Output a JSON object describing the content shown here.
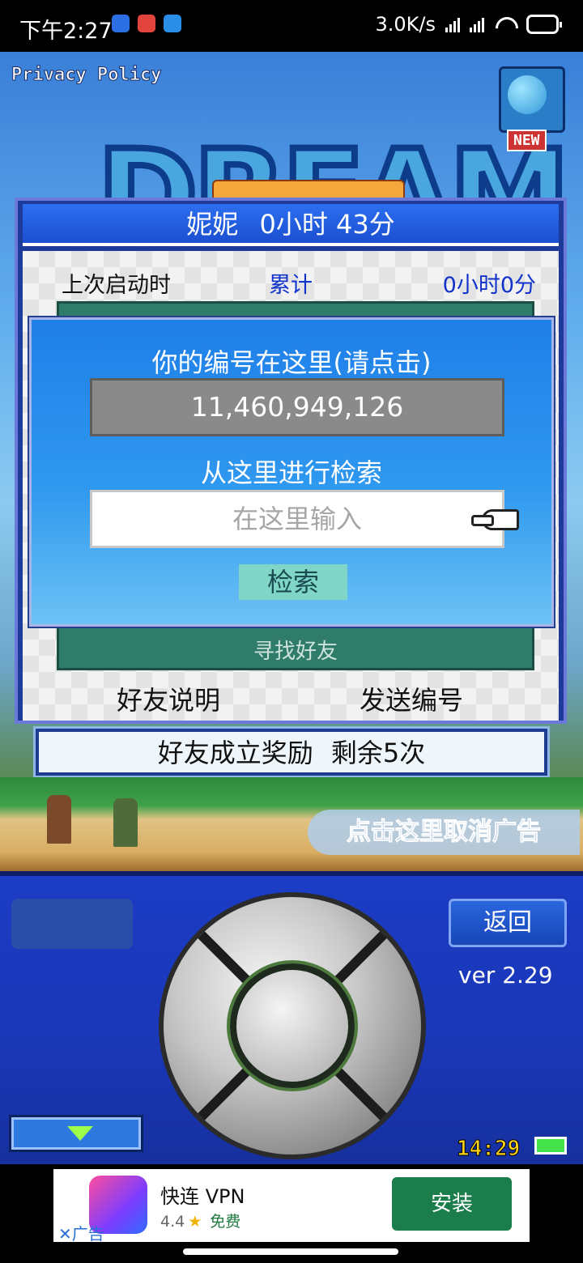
{
  "status_bar": {
    "time": "下午2:27",
    "network_speed": "3.0K/s",
    "icons": [
      "notification-app-icon",
      "notification-app-icon",
      "notification-app-icon",
      "signal-icon",
      "signal-icon",
      "wifi-icon",
      "battery-icon"
    ]
  },
  "game": {
    "privacy_policy": "Privacy Policy",
    "logo_text": "DREAM",
    "new_badge": "NEW"
  },
  "friend_dialog": {
    "title_name": "妮妮",
    "title_time": "0小时 43分",
    "last_launch_label": "上次启动时",
    "accumulated_label": "累计",
    "accumulated_value": "0小时0分",
    "find_friends": "寻找好友",
    "friend_help": "好友说明",
    "send_id": "发送编号"
  },
  "search_overlay": {
    "id_title": "你的编号在这里(请点击)",
    "id_value": "11,460,949,126",
    "search_title": "从这里进行检索",
    "search_placeholder": "在这里输入",
    "search_button": "检索"
  },
  "reward_bar": {
    "label": "好友成立奖励",
    "remaining": "剩余5次"
  },
  "cancel_ad": "点击这里取消广告",
  "controls": {
    "back_button": "返回",
    "version": "ver 2.29",
    "clock": "14:29"
  },
  "ad_banner": {
    "app_name": "快连 VPN",
    "rating": "4.4",
    "free_label": "免费",
    "install_button": "安装",
    "ad_label": "✕广告"
  },
  "colors": {
    "dialog_title": "#1b4fd0",
    "overlay": "#2f98ef",
    "install": "#1a7d4b",
    "controls_bg": "#1a37b6"
  }
}
